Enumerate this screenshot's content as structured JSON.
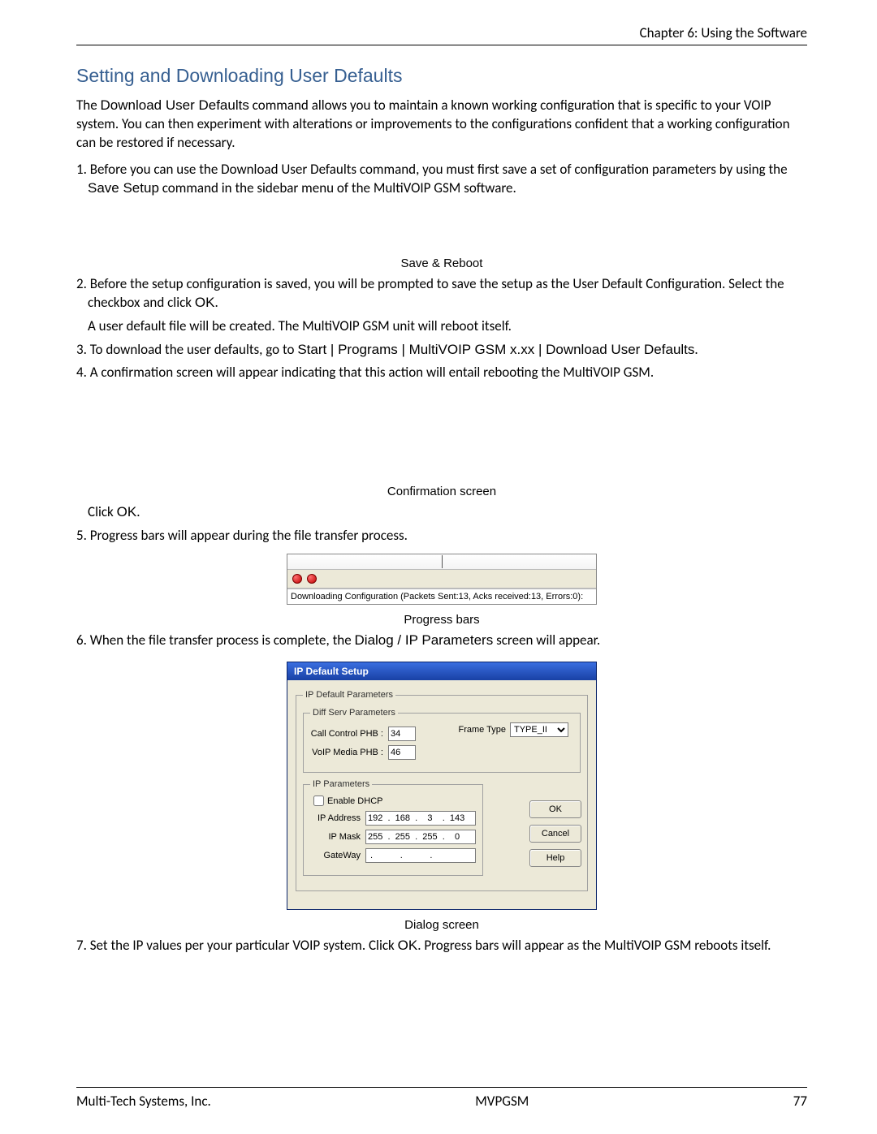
{
  "header": {
    "chapter": "Chapter 6: Using the Software"
  },
  "section_title": "Setting and Downloading User Defaults",
  "intro": {
    "prefix": "The ",
    "cmd": "Download User Defaults",
    "rest": " command allows you to maintain a known working configuration that is specific to your VOIP system.  You can then experiment with alterations or improvements to the configurations confident that a working configuration can be restored if necessary."
  },
  "steps": {
    "s1a": "1. Before you can use the Download User Defaults command, you must first save a set of configuration parameters by using the ",
    "s1b": "Save Setup",
    "s1c": " command in the sidebar menu of the MultiVOIP GSM software.",
    "s2a": "2. Before the setup configuration is saved, you will be prompted to save the setup as the User Default Configuration. Select the checkbox and click ",
    "ok": "OK",
    "s2b": ".",
    "s2c": "A user default file will be created.  The MultiVOIP GSM unit will reboot itself.",
    "s3a": "3. To download the user defaults, go to ",
    "s3path": "Start |  Programs |  MultiVOIP GSM x.xx |  Download User Defaults",
    "s3b": ".",
    "s4": "4. A confirmation screen will appear indicating that this action will entail rebooting the MultiVOIP GSM.",
    "click": "Click ",
    "s5": "5. Progress bars will appear during the file transfer process.",
    "s6a": "6. When the file transfer process is complete, the ",
    "s6b": "Dialog /  IP Parameters",
    "s6c": " screen will appear.",
    "s7a": "7. Set the IP values per your particular VOIP system.  Click ",
    "s7b": ".  Progress bars will appear as the MultiVOIP GSM reboots itself."
  },
  "captions": {
    "save_reboot": "Save & Reboot",
    "confirm": "Confirmation screen",
    "progress": "Progress bars",
    "dialog": "Dialog screen"
  },
  "progress": {
    "status": "Downloading Configuration (Packets Sent:13, Acks received:13, Errors:0):"
  },
  "dialog": {
    "title": "IP Default Setup",
    "grp_default": "IP Default Parameters",
    "grp_diff": "Diff Serv Parameters",
    "call_phb_label": "Call Control PHB :",
    "call_phb": "34",
    "voip_phb_label": "VoIP Media PHB :",
    "voip_phb": "46",
    "frame_label": "Frame Type",
    "frame_value": "TYPE_II",
    "grp_ip": "IP Parameters",
    "enable_dhcp": "Enable DHCP",
    "ip_address_label": "IP Address",
    "ip_address": "192  .  168  .    3    .  143",
    "ip_mask_label": "IP Mask",
    "ip_mask": "255  .  255  .  255  .    0",
    "gateway_label": "GateWay",
    "gateway": " .           .           .  ",
    "btn_ok": "OK",
    "btn_cancel": "Cancel",
    "btn_help": "Help"
  },
  "footer": {
    "left": "Multi-Tech Systems, Inc.",
    "center": "MVPGSM",
    "right": "77"
  }
}
